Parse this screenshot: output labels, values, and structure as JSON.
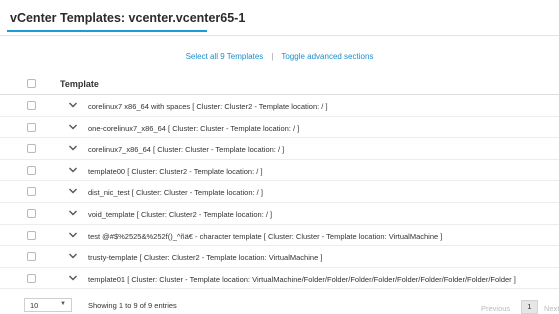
{
  "header": {
    "title": "vCenter Templates: vcenter.vcenter65-1"
  },
  "actions": {
    "select_all": "Select all 9 Templates",
    "separator": "|",
    "toggle_advanced": "Toggle advanced sections"
  },
  "table": {
    "column_header": "Template",
    "rows": [
      "corelinux7 x86_64 with spaces [ Cluster: Cluster2 - Template location: / ]",
      "one-corelinux7_x86_64 [ Cluster: Cluster - Template location: / ]",
      "corelinux7_x86_64 [ Cluster: Cluster - Template location: / ]",
      "template00 [ Cluster: Cluster2 - Template location: / ]",
      "dist_nic_test [ Cluster: Cluster - Template location: / ]",
      "void_template [ Cluster: Cluster2 - Template location: / ]",
      "test @#$%2525&%252f()_^ñä€ - character template [ Cluster: Cluster - Template location: VirtualMachine ]",
      "trusty-template [ Cluster: Cluster2 - Template location: VirtualMachine ]",
      "template01 [ Cluster: Cluster - Template location: VirtualMachine/Folder/Folder/Folder/Folder/Folder/Folder/Folder/Folder/Folder ]"
    ]
  },
  "footer": {
    "page_size": "10",
    "page_size_arrow": "▼",
    "showing": "Showing 1 to 9 of 9 entries",
    "previous": "Previous",
    "current_page": "1",
    "next": "Next"
  },
  "colors": {
    "accent": "#1e9bd7",
    "link": "#1a8fd0"
  }
}
